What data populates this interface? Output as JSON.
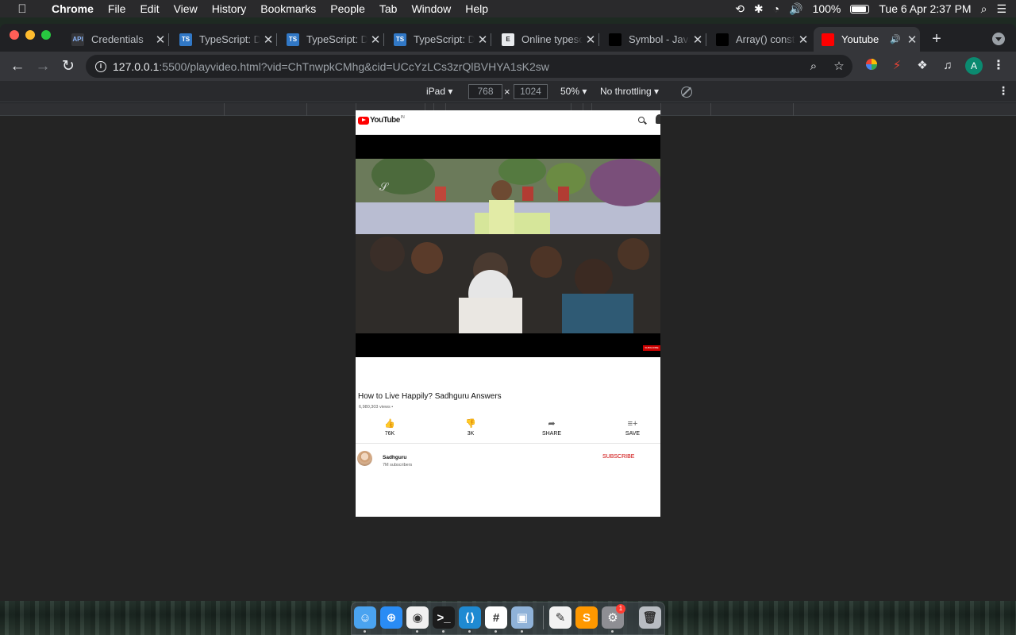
{
  "menubar": {
    "app_name": "Chrome",
    "menus": [
      "File",
      "Edit",
      "View",
      "History",
      "Bookmarks",
      "People",
      "Tab",
      "Window",
      "Help"
    ],
    "battery_percent": "100%",
    "datetime": "Tue 6 Apr  2:37 PM"
  },
  "tabs": [
    {
      "title": "Credentials",
      "favicon": "API",
      "favicon_color": "#35363a",
      "favicon_text_color": "#8ab4f8"
    },
    {
      "title": "TypeScript: Documentation",
      "favicon": "TS",
      "favicon_color": "#3178c6",
      "favicon_text_color": "#ffffff"
    },
    {
      "title": "TypeScript: Documentation",
      "favicon": "TS",
      "favicon_color": "#3178c6",
      "favicon_text_color": "#ffffff"
    },
    {
      "title": "TypeScript: Documentation",
      "favicon": "TS",
      "favicon_color": "#3178c6",
      "favicon_text_color": "#ffffff"
    },
    {
      "title": "Online typescript",
      "favicon": "E",
      "favicon_color": "#e8eaed",
      "favicon_text_color": "#202124"
    },
    {
      "title": "Symbol - JavaScript",
      "favicon": "",
      "favicon_color": "#000000",
      "favicon_text_color": "#ffffff"
    },
    {
      "title": "Array() constructor",
      "favicon": "",
      "favicon_color": "#000000",
      "favicon_text_color": "#ffffff"
    },
    {
      "title": "Youtube",
      "favicon": "",
      "favicon_color": "#ff0000",
      "favicon_text_color": "#ffffff",
      "active": true
    }
  ],
  "address_bar": {
    "host": "127.0.0.1",
    "rest": ":5500/playvideo.html?vid=ChTnwpkCMhg&cid=UCcYzLCs3zrQlBVHYA1sK2sw"
  },
  "profile_initial": "A",
  "device_toolbar": {
    "device": "iPad ▾",
    "width": "768",
    "height": "1024",
    "zoom": "50% ▾",
    "throttling": "No throttling ▾"
  },
  "youtube": {
    "logo_text": "YouTube",
    "logo_region": "IN",
    "video": {
      "title": "How to Live Happily? Sadhguru Answers",
      "views": "6,980,303 views •",
      "overlay_subscribe": "SUBSCRIBE"
    },
    "actions": [
      {
        "icon": "thumbs-up-icon",
        "glyph": "👍",
        "label": "76K"
      },
      {
        "icon": "thumbs-down-icon",
        "glyph": "👎",
        "label": "3K"
      },
      {
        "icon": "share-icon",
        "glyph": "➦",
        "label": "SHARE"
      },
      {
        "icon": "save-icon",
        "glyph": "≡+",
        "label": "SAVE"
      }
    ],
    "channel": {
      "name": "Sadhguru",
      "subscribers": "7M subscribers",
      "subscribe_label": "SUBSCRIBE"
    }
  },
  "dock": [
    {
      "name": "finder",
      "color": "#4aa3f0",
      "glyph": "☺"
    },
    {
      "name": "safari",
      "color": "#2a8cf5",
      "glyph": "⊕"
    },
    {
      "name": "chrome",
      "color": "#f0f0f0",
      "glyph": "◉"
    },
    {
      "name": "terminal",
      "color": "#1c1c1c",
      "glyph": ">_"
    },
    {
      "name": "vscode",
      "color": "#1f8ad2",
      "glyph": "⟨⟩"
    },
    {
      "name": "slack",
      "color": "#ffffff",
      "glyph": "#"
    },
    {
      "name": "preview",
      "color": "#8fb2d8",
      "glyph": "▣"
    },
    {
      "name": "textedit",
      "color": "#f2f2f2",
      "glyph": "✎"
    },
    {
      "name": "sublime-text",
      "color": "#ff9800",
      "glyph": "S"
    },
    {
      "name": "system-preferences",
      "color": "#8e8e93",
      "glyph": "⚙"
    },
    {
      "name": "trash",
      "color": "#b8bcc2",
      "glyph": "🗑"
    }
  ],
  "dock_badge": "1",
  "colors": {
    "menubar": "#2a2a2c",
    "tabstrip": "#202124",
    "active_tab": "#35363a",
    "page_background": "#ffffff",
    "youtube_red": "#ff0000"
  }
}
